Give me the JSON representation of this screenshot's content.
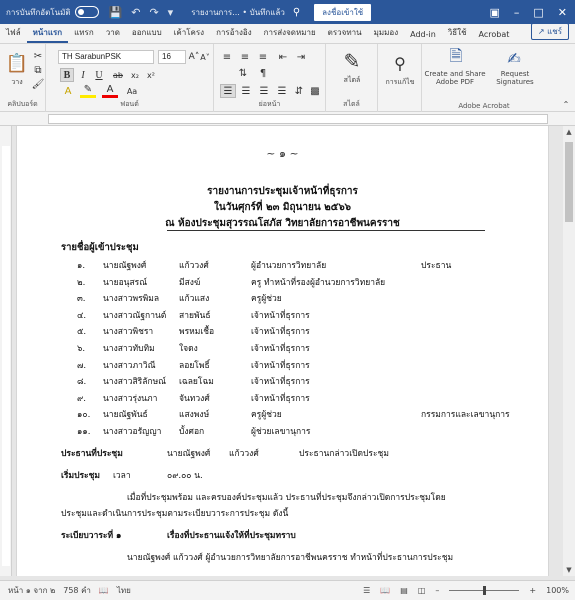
{
  "titlebar": {
    "autosave_label": "การบันทึกอัตโนมัติ",
    "filename": "รายงานการ... • บันทึกแล้ว",
    "signin_label": "ลงชื่อเข้าใช้"
  },
  "tabs": [
    "ไฟล์",
    "หน้าแรก",
    "แทรก",
    "วาด",
    "ออกแบบ",
    "เค้าโครง",
    "การอ้างอิง",
    "การส่งจดหมาย",
    "ตรวจทาน",
    "มุมมอง",
    "Add-in",
    "วิธีใช้",
    "Acrobat"
  ],
  "active_tab": "หน้าแรก",
  "share_label": "แชร์",
  "ribbon": {
    "paste_label": "วาง",
    "clipboard_group": "คลิปบอร์ด",
    "font_name": "TH SarabunPSK",
    "font_size": "16",
    "font_group": "ฟอนต์",
    "paragraph_group": "ย่อหน้า",
    "styles_label": "สไตล์",
    "styles_group": "สไตล์",
    "editing_label": "การแก้ไข",
    "create_pdf_label": "Create and Share Adobe PDF",
    "request_sig_label": "Request Signatures",
    "acrobat_group": "Adobe Acrobat"
  },
  "document": {
    "ornament": "~ ๑ ~",
    "title_line1": "รายงานการประชุมเจ้าหน้าที่ธุรการ",
    "title_line2": "ในวันศุกร์ที่ ๒๓ มิถุนายน ๒๕๖๖",
    "title_line3": "ณ ห้องประชุมสุวรรณโสภัส วิทยาลัยการอาชีพนครราช",
    "attendees_heading": "รายชื่อผู้เข้าประชุม",
    "attendees": [
      {
        "no": "๑.",
        "first": "นายณัฐพงศ์",
        "last": "แก้ววงศ์",
        "position": "ผู้อำนวยการวิทยาลัย",
        "note": "ประธาน"
      },
      {
        "no": "๒.",
        "first": "นายอนุสรณ์",
        "last": "มีสงฆ์",
        "position": "ครู ทำหน้าที่รองผู้อำนวยการวิทยาลัย",
        "note": ""
      },
      {
        "no": "๓.",
        "first": "นางสาวพรพิมล",
        "last": "แก้วแสง",
        "position": "ครูผู้ช่วย",
        "note": ""
      },
      {
        "no": "๔.",
        "first": "นางสาวณัฐกานต์",
        "last": "สายพันธ์",
        "position": "เจ้าหน้าที่ธุรการ",
        "note": ""
      },
      {
        "no": "๕.",
        "first": "นางสาวพิชรา",
        "last": "พรหมเชื้อ",
        "position": "เจ้าหน้าที่ธุรการ",
        "note": ""
      },
      {
        "no": "๖.",
        "first": "นางสาวทับทิม",
        "last": "ใจดง",
        "position": "เจ้าหน้าที่ธุรการ",
        "note": ""
      },
      {
        "no": "๗.",
        "first": "นางสาวภาวิณี",
        "last": "ลอยโพธิ์",
        "position": "เจ้าหน้าที่ธุรการ",
        "note": ""
      },
      {
        "no": "๘.",
        "first": "นางสาวสิริลักษณ์",
        "last": "เฉลยโฉม",
        "position": "เจ้าหน้าที่ธุรการ",
        "note": ""
      },
      {
        "no": "๙.",
        "first": "นางสาวรุ่งนภา",
        "last": "จันทวงศ์",
        "position": "เจ้าหน้าที่ธุรการ",
        "note": ""
      },
      {
        "no": "๑๐.",
        "first": "นายณัฐพันธ์",
        "last": "แสงพงษ์",
        "position": "ครูผู้ช่วย",
        "note": "กรรมการและเลขานุการ"
      },
      {
        "no": "๑๑.",
        "first": "นางสาวอรัญญา",
        "last": "บั้งศอก",
        "position": "ผู้ช่วยเลขานุการ",
        "note": ""
      }
    ],
    "chair_label": "ประธานที่ประชุม",
    "chair_name": "นายณัฐพงศ์",
    "chair_surname": "แก้ววงศ์",
    "chair_role": "ประธานกล่าวเปิดประชุม",
    "start_label": "เริ่มประชุม",
    "start_time_label": "เวลา",
    "start_time": "๐๙.๐๐ น.",
    "para1_line1": "เมื่อที่ประชุมพร้อม และครบองค์ประชุมแล้ว ประธานที่ประชุมจึงกล่าวเปิดการประชุมโดย",
    "para1_line2": "ประชุมและดำเนินการประชุมตามระเบียบวาระการประชุม ดังนี้",
    "agenda1_label": "ระเบียบวาระที่ ๑",
    "agenda1_title": "เรื่องที่ประธานแจ้งให้ที่ประชุมทราบ",
    "para2_line1": "นายณัฐพงศ์ แก้ววงศ์ ผู้อำนวยการวิทยาลัยการอาชีพนครราช ทำหน้าที่ประธานการประชุม"
  },
  "statusbar": {
    "page": "หน้า ๑ จาก ๒",
    "words": "758 คำ",
    "language": "ไทย",
    "zoom": "100%"
  }
}
